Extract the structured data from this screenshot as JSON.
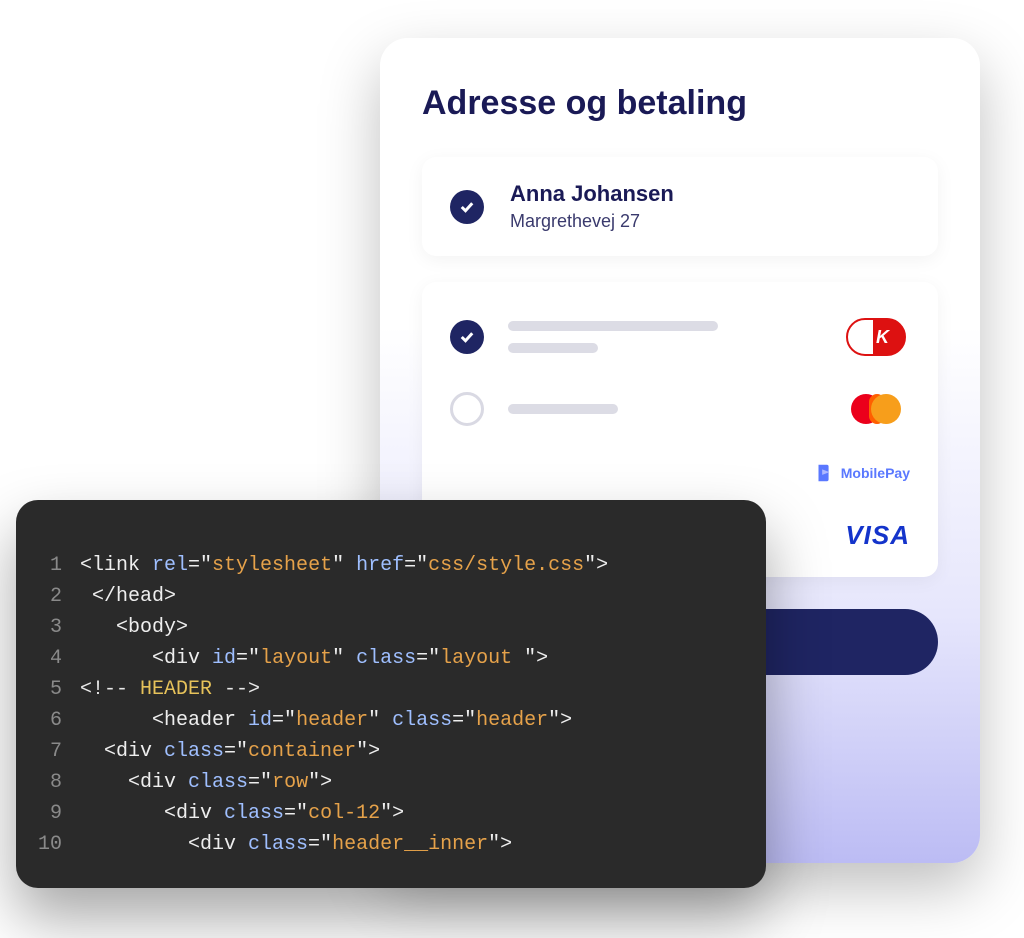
{
  "checkout": {
    "title": "Adresse og betaling",
    "address": {
      "name": "Anna Johansen",
      "street": "Margrethevej 27"
    },
    "payment_options": [
      {
        "brand": "Dankort",
        "selected": true
      },
      {
        "brand": "Mastercard",
        "selected": false
      },
      {
        "brand": "MobilePay",
        "selected": false
      },
      {
        "brand": "Visa",
        "selected": false
      }
    ],
    "mobilepay_label": "MobilePay",
    "visa_label": "VISA"
  },
  "code": {
    "lines": [
      {
        "n": "1",
        "segments": [
          {
            "t": "<link ",
            "c": "tok-tag"
          },
          {
            "t": "rel",
            "c": "tok-attr"
          },
          {
            "t": "=\"",
            "c": "tok-tag"
          },
          {
            "t": "stylesheet",
            "c": "tok-str"
          },
          {
            "t": "\" ",
            "c": "tok-tag"
          },
          {
            "t": "href",
            "c": "tok-attr"
          },
          {
            "t": "=\"",
            "c": "tok-tag"
          },
          {
            "t": "css/style.css",
            "c": "tok-str"
          },
          {
            "t": "\">",
            "c": "tok-tag"
          }
        ]
      },
      {
        "n": "2",
        "segments": [
          {
            "t": " </head>",
            "c": "tok-tag"
          }
        ]
      },
      {
        "n": "3",
        "segments": [
          {
            "t": "   <body>",
            "c": "tok-tag"
          }
        ]
      },
      {
        "n": "4",
        "segments": [
          {
            "t": "      <div ",
            "c": "tok-tag"
          },
          {
            "t": "id",
            "c": "tok-attr"
          },
          {
            "t": "=\"",
            "c": "tok-tag"
          },
          {
            "t": "layout",
            "c": "tok-str"
          },
          {
            "t": "\" ",
            "c": "tok-tag"
          },
          {
            "t": "class",
            "c": "tok-attr"
          },
          {
            "t": "=\"",
            "c": "tok-tag"
          },
          {
            "t": "layout ",
            "c": "tok-str"
          },
          {
            "t": "\">",
            "c": "tok-tag"
          }
        ]
      },
      {
        "n": "5",
        "segments": [
          {
            "t": "<!-- ",
            "c": "tok-com"
          },
          {
            "t": "HEADER",
            "c": "tok-kw"
          },
          {
            "t": " -->",
            "c": "tok-com"
          }
        ]
      },
      {
        "n": "6",
        "segments": [
          {
            "t": "      <header ",
            "c": "tok-tag"
          },
          {
            "t": "id",
            "c": "tok-attr"
          },
          {
            "t": "=\"",
            "c": "tok-tag"
          },
          {
            "t": "header",
            "c": "tok-str"
          },
          {
            "t": "\" ",
            "c": "tok-tag"
          },
          {
            "t": "class",
            "c": "tok-attr"
          },
          {
            "t": "=\"",
            "c": "tok-tag"
          },
          {
            "t": "header",
            "c": "tok-str"
          },
          {
            "t": "\">",
            "c": "tok-tag"
          }
        ]
      },
      {
        "n": "7",
        "segments": [
          {
            "t": "  <div ",
            "c": "tok-tag"
          },
          {
            "t": "class",
            "c": "tok-attr"
          },
          {
            "t": "=\"",
            "c": "tok-tag"
          },
          {
            "t": "container",
            "c": "tok-str"
          },
          {
            "t": "\">",
            "c": "tok-tag"
          }
        ]
      },
      {
        "n": "8",
        "segments": [
          {
            "t": "    <div ",
            "c": "tok-tag"
          },
          {
            "t": "class",
            "c": "tok-attr"
          },
          {
            "t": "=\"",
            "c": "tok-tag"
          },
          {
            "t": "row",
            "c": "tok-str"
          },
          {
            "t": "\">",
            "c": "tok-tag"
          }
        ]
      },
      {
        "n": "9",
        "segments": [
          {
            "t": "       <div ",
            "c": "tok-tag"
          },
          {
            "t": "class",
            "c": "tok-attr"
          },
          {
            "t": "=\"",
            "c": "tok-tag"
          },
          {
            "t": "col-12",
            "c": "tok-str"
          },
          {
            "t": "\">",
            "c": "tok-tag"
          }
        ]
      },
      {
        "n": "10",
        "segments": [
          {
            "t": "         <div ",
            "c": "tok-tag"
          },
          {
            "t": "class",
            "c": "tok-attr"
          },
          {
            "t": "=\"",
            "c": "tok-tag"
          },
          {
            "t": "header__inner",
            "c": "tok-str"
          },
          {
            "t": "\">",
            "c": "tok-tag"
          }
        ]
      }
    ]
  }
}
